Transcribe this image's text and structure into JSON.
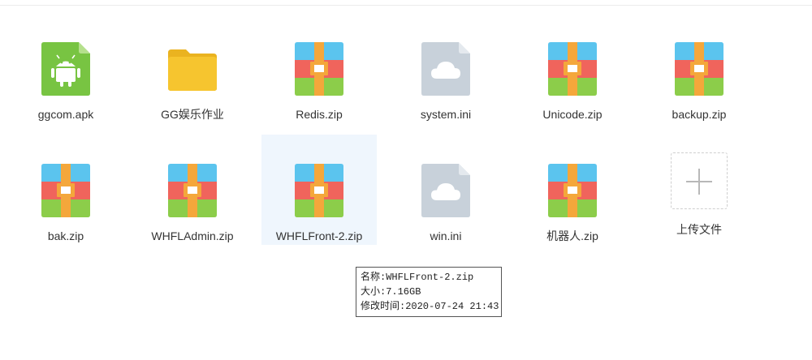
{
  "files": [
    {
      "name": "ggcom.apk",
      "icon": "android-apk-icon"
    },
    {
      "name": "GG娱乐作业",
      "icon": "folder-icon"
    },
    {
      "name": "Redis.zip",
      "icon": "zip-archive-icon"
    },
    {
      "name": "system.ini",
      "icon": "cloud-doc-icon"
    },
    {
      "name": "Unicode.zip",
      "icon": "zip-archive-icon"
    },
    {
      "name": "backup.zip",
      "icon": "zip-archive-icon"
    },
    {
      "name": "bak.zip",
      "icon": "zip-archive-icon"
    },
    {
      "name": "WHFLAdmin.zip",
      "icon": "zip-archive-icon"
    },
    {
      "name": "WHFLFront-2.zip",
      "icon": "zip-archive-icon",
      "selected": true
    },
    {
      "name": "win.ini",
      "icon": "cloud-doc-icon"
    },
    {
      "name": "机器人.zip",
      "icon": "zip-archive-icon"
    }
  ],
  "upload": {
    "label": "上传文件",
    "icon": "plus-icon"
  },
  "tooltip": {
    "name_line": "名称:WHFLFront-2.zip",
    "size_line": "大小:7.16GB",
    "modified_line": "修改时间:2020-07-24 21:43"
  },
  "colors": {
    "android": "#78c442",
    "folder": "#f6c52f",
    "zip_blue": "#5bc4ee",
    "zip_red": "#f0645c",
    "zip_green": "#8ccd4a",
    "zip_band": "#f4a73b",
    "doc_gray": "#c8d1da",
    "selected_bg": "#eff6fd"
  }
}
